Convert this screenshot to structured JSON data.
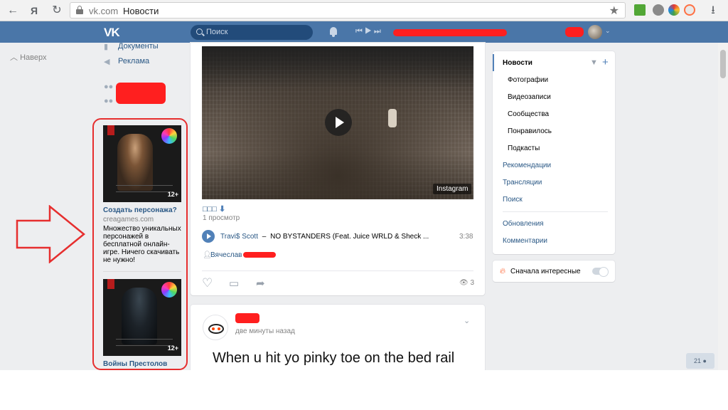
{
  "browser": {
    "domain": "vk.com",
    "page_title": "Новости",
    "back_glyph": "←",
    "yandex_glyph": "Я",
    "reload_glyph": "↻",
    "star_glyph": "★",
    "download_glyph": "⭳"
  },
  "header": {
    "logo": "VK",
    "search_placeholder": "Поиск",
    "player_controls": "⏮  ▶  ⏭",
    "accent_color": "#4a76a8"
  },
  "left_sidebar": {
    "up_label": "Наверх",
    "items": [
      {
        "label": "Документы",
        "icon": "document-icon"
      },
      {
        "label": "Реклама",
        "icon": "megaphone-icon"
      }
    ],
    "ads": [
      {
        "rating": "12+",
        "title": "Создать персонажа?",
        "domain": "creagames.com",
        "desc": "Множество уникальных персонажей в бесплатной онлайн-игре. Ничего скачивать не нужно!"
      },
      {
        "rating": "12+",
        "title": "Войны Престолов"
      }
    ]
  },
  "post1": {
    "video_badge": "Instagram",
    "views_label": "1 просмотр",
    "track_artist": "Travi$ Scott",
    "track_dash": "–",
    "track_title": "NO BYSTANDERS (Feat. Juice WRLD & Sheck ...",
    "track_duration": "3:38",
    "author": "Вячеслав",
    "view_count": "3"
  },
  "post2": {
    "time": "две минуты назад",
    "text": "When u hit yo pinky toe on the bed rail"
  },
  "right_menu": {
    "items": [
      "Новости",
      "Фотографии",
      "Видеозаписи",
      "Сообщества",
      "Понравилось",
      "Подкасты",
      "Рекомендации",
      "Трансляции",
      "Поиск",
      "Обновления",
      "Комментарии"
    ],
    "sort_label": "Сначала интересные"
  },
  "floating_counter": "21"
}
